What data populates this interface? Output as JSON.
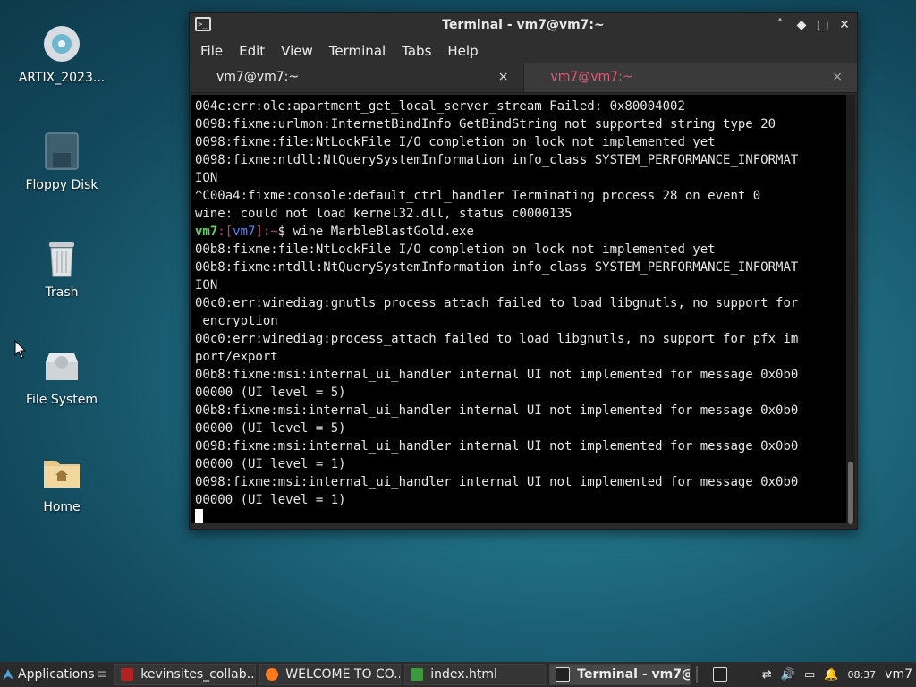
{
  "desktop": {
    "icons": [
      {
        "label": "ARTIX_2023..."
      },
      {
        "label": "Floppy Disk"
      },
      {
        "label": "Trash"
      },
      {
        "label": "File System"
      },
      {
        "label": "Home"
      }
    ]
  },
  "window": {
    "title": "Terminal - vm7@vm7:~",
    "menu": [
      "File",
      "Edit",
      "View",
      "Terminal",
      "Tabs",
      "Help"
    ],
    "tabs": [
      {
        "label": "vm7@vm7:~",
        "close": "×"
      },
      {
        "label": "vm7@vm7:~",
        "close": "×"
      }
    ],
    "controls": {
      "min": "˄",
      "max": "▢",
      "more": "◆",
      "close": "✕"
    }
  },
  "terminal": {
    "lines": [
      "004c:err:ole:apartment_get_local_server_stream Failed: 0x80004002",
      "0098:fixme:urlmon:InternetBindInfo_GetBindString not supported string type 20",
      "0098:fixme:file:NtLockFile I/O completion on lock not implemented yet",
      "0098:fixme:ntdll:NtQuerySystemInformation info_class SYSTEM_PERFORMANCE_INFORMAT",
      "ION",
      "^C00a4:fixme:console:default_ctrl_handler Terminating process 28 on event 0",
      "wine: could not load kernel32.dll, status c0000135"
    ],
    "prompt": {
      "user": "vm7",
      "open": ":[",
      "host": "vm7",
      "close": "]:~",
      "symbol": "$",
      "command": " wine MarbleBlastGold.exe"
    },
    "output": [
      "00b8:fixme:file:NtLockFile I/O completion on lock not implemented yet",
      "00b8:fixme:ntdll:NtQuerySystemInformation info_class SYSTEM_PERFORMANCE_INFORMAT",
      "ION",
      "00c0:err:winediag:gnutls_process_attach failed to load libgnutls, no support for",
      " encryption",
      "00c0:err:winediag:process_attach failed to load libgnutls, no support for pfx im",
      "port/export",
      "00b8:fixme:msi:internal_ui_handler internal UI not implemented for message 0x0b0",
      "00000 (UI level = 5)",
      "00b8:fixme:msi:internal_ui_handler internal UI not implemented for message 0x0b0",
      "00000 (UI level = 5)",
      "0098:fixme:msi:internal_ui_handler internal UI not implemented for message 0x0b0",
      "00000 (UI level = 1)",
      "0098:fixme:msi:internal_ui_handler internal UI not implemented for message 0x0b0",
      "00000 (UI level = 1)"
    ]
  },
  "taskbar": {
    "apps_label": "Applications",
    "items": [
      {
        "label": "kevinsites_collab...",
        "icon": "filezilla-icon",
        "color": "#b22222"
      },
      {
        "label": "WELCOME TO CO...",
        "icon": "firefox-icon",
        "color": "#ff7a1a"
      },
      {
        "label": "index.html",
        "icon": "editor-icon",
        "color": "#3c9a3c"
      },
      {
        "label": "Terminal - vm7@...",
        "icon": "terminal-icon",
        "color": "#dddddd"
      }
    ],
    "clock": "08:37",
    "user": "vm7"
  }
}
